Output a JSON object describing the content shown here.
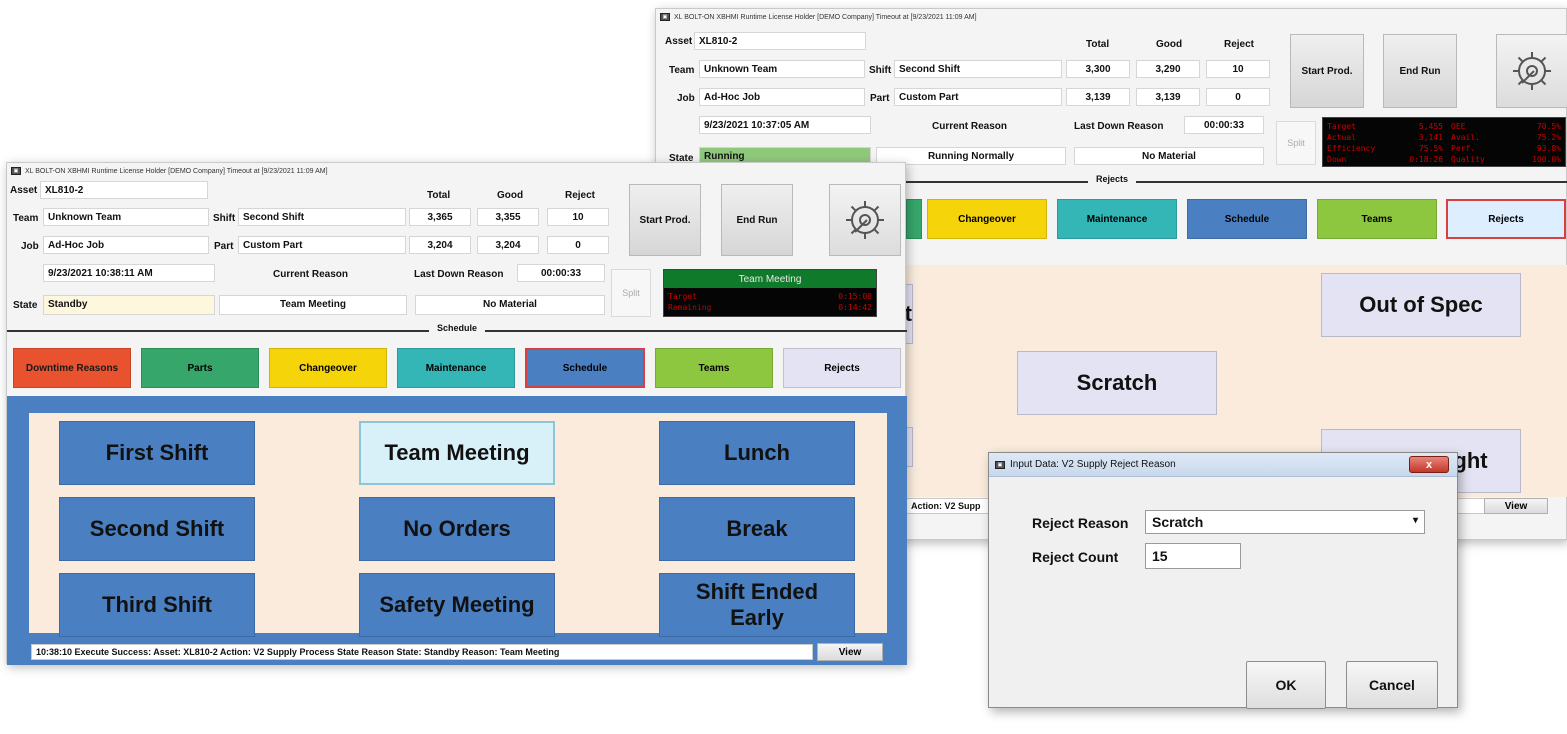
{
  "back_window": {
    "title": "XL BOLT-ON XBHMI Runtime   License Holder [DEMO Company] Timeout at [9/23/2021 11:09 AM]",
    "asset_label": "Asset",
    "asset_value": "XL810-2",
    "team_label": "Team",
    "team_value": "Unknown Team",
    "shift_label": "Shift",
    "shift_value": "Second Shift",
    "job_label": "Job",
    "job_value": "Ad-Hoc Job",
    "part_label": "Part",
    "part_value": "Custom Part",
    "datetime": "9/23/2021 10:37:05 AM",
    "state_label": "State",
    "state_value": "Running",
    "current_reason_label": "Current Reason",
    "current_reason_value": "Running Normally",
    "last_down_label": "Last Down Reason",
    "last_down_time": "00:00:33",
    "last_down_value": "No Material",
    "col_total": "Total",
    "col_good": "Good",
    "col_reject": "Reject",
    "row1": {
      "total": "3,300",
      "good": "3,290",
      "reject": "10"
    },
    "row2": {
      "total": "3,139",
      "good": "3,139",
      "reject": "0"
    },
    "start_prod": "Start Prod.",
    "end_run": "End Run",
    "split": "Split",
    "lcd": {
      "left_labels": [
        "Target",
        "Actual",
        "Efficiency",
        "Down"
      ],
      "left_values": [
        "5,455",
        "3,141",
        "75.5%",
        "0:18:26"
      ],
      "right_labels": [
        "OEE",
        "Avail.",
        "Perf.",
        "Quality"
      ],
      "right_values": [
        "70.5%",
        "75.2%",
        "93.8%",
        "100.0%"
      ]
    },
    "section_title": "Rejects",
    "categories": [
      "Changeover",
      "Maintenance",
      "Schedule",
      "Teams",
      "Rejects"
    ],
    "reasons": [
      "Out of Spec",
      "Scratch",
      "Underweight"
    ],
    "status_text": "Action: V2 Supp",
    "view": "View"
  },
  "front_window": {
    "title": "XL BOLT-ON XBHMI Runtime   License Holder [DEMO Company] Timeout at [9/23/2021 11:09 AM]",
    "asset_label": "Asset",
    "asset_value": "XL810-2",
    "team_label": "Team",
    "team_value": "Unknown Team",
    "shift_label": "Shift",
    "shift_value": "Second Shift",
    "job_label": "Job",
    "job_value": "Ad-Hoc Job",
    "part_label": "Part",
    "part_value": "Custom Part",
    "datetime": "9/23/2021 10:38:11 AM",
    "state_label": "State",
    "state_value": "Standby",
    "current_reason_label": "Current Reason",
    "current_reason_value": "Team Meeting",
    "last_down_label": "Last Down Reason",
    "last_down_time": "00:00:33",
    "last_down_value": "No Material",
    "col_total": "Total",
    "col_good": "Good",
    "col_reject": "Reject",
    "row1": {
      "total": "3,365",
      "good": "3,355",
      "reject": "10"
    },
    "row2": {
      "total": "3,204",
      "good": "3,204",
      "reject": "0"
    },
    "start_prod": "Start Prod.",
    "end_run": "End Run",
    "split": "Split",
    "meeting": {
      "header": "Team Meeting",
      "labels": [
        "Target",
        "Remaining"
      ],
      "values": [
        "0:15:00",
        "0:14:42"
      ]
    },
    "section_title": "Schedule",
    "categories": [
      "Downtime Reasons",
      "Parts",
      "Changeover",
      "Maintenance",
      "Schedule",
      "Teams",
      "Rejects"
    ],
    "schedule_buttons": [
      "First Shift",
      "Team Meeting",
      "Lunch",
      "Second Shift",
      "No Orders",
      "Break",
      "Third Shift",
      "Safety Meeting",
      "Shift Ended Early"
    ],
    "status_text": "10:38:10 Execute Success:  Asset: XL810-2 Action: V2 Supply Process State Reason State: Standby Reason: Team Meeting",
    "view": "View"
  },
  "dialog": {
    "title": "Input Data: V2 Supply Reject Reason",
    "close": "x",
    "reason_label": "Reject Reason",
    "reason_value": "Scratch",
    "count_label": "Reject Count",
    "count_value": "15",
    "ok": "OK",
    "cancel": "Cancel"
  },
  "colors": {
    "downtime": "#e8522e",
    "parts": "#36a66a",
    "changeover": "#f6d40a",
    "maintenance": "#34b6b6",
    "schedule": "#4a7fc1",
    "teams": "#8dc63f",
    "rejects": "#e3e3f3",
    "panel_bg": "#faebdc",
    "schedule_frame": "#4a7fc1",
    "running": "#8ec97b",
    "standby": "#fdf7dd",
    "meeting_green": "#0f7a2a"
  }
}
